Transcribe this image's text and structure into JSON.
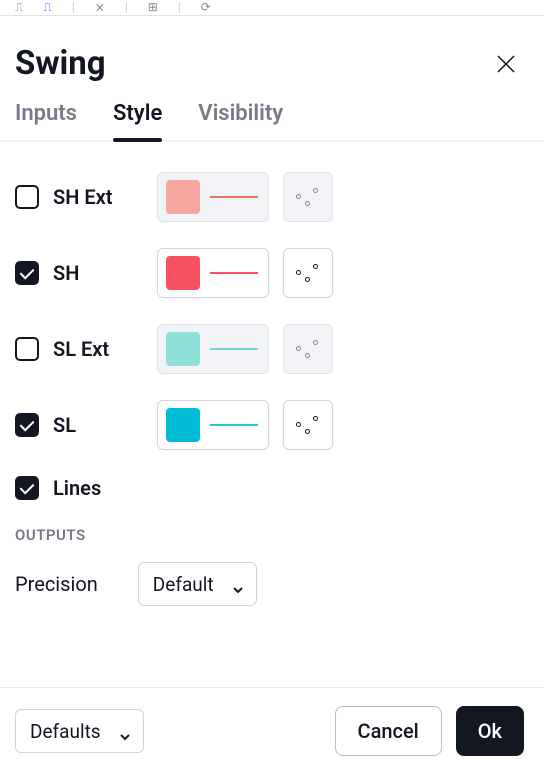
{
  "dialog": {
    "title": "Swing"
  },
  "tabs": {
    "inputs": "Inputs",
    "style": "Style",
    "visibility": "Visibility",
    "active": "style"
  },
  "rows": [
    {
      "label": "SH Ext",
      "checked": false,
      "color": "#f8a7a0",
      "line_color": "#f2726a",
      "disabled": true
    },
    {
      "label": "SH",
      "checked": true,
      "color": "#f7525f",
      "line_color": "#f7525f",
      "disabled": false
    },
    {
      "label": "SL Ext",
      "checked": false,
      "color": "#8fe0db",
      "line_color": "#6fd6d0",
      "disabled": true
    },
    {
      "label": "SL",
      "checked": true,
      "color": "#00bcd4",
      "line_color": "#22c7d6",
      "disabled": false
    },
    {
      "label": "Lines",
      "checked": true,
      "color": null,
      "line_color": null,
      "disabled": false
    }
  ],
  "outputs": {
    "heading": "OUTPUTS",
    "precision_label": "Precision",
    "precision_value": "Default"
  },
  "footer": {
    "defaults": "Defaults",
    "cancel": "Cancel",
    "ok": "Ok"
  }
}
